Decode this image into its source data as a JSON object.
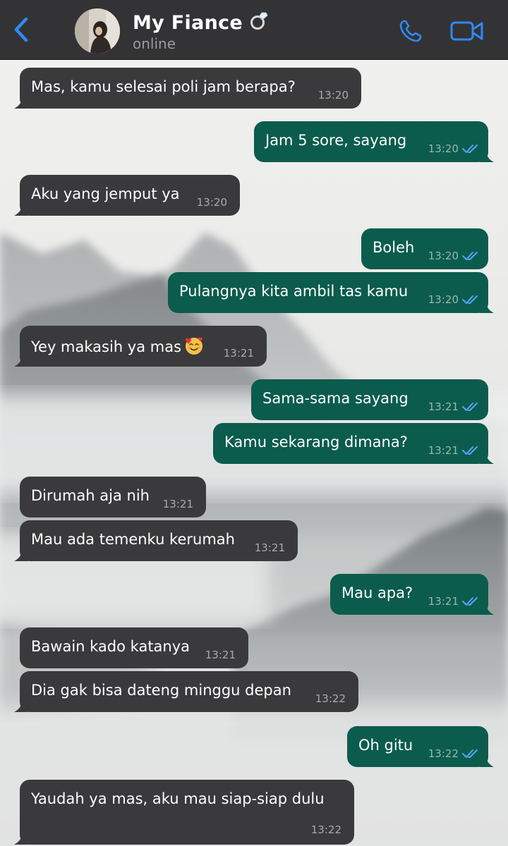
{
  "header": {
    "contact_name": "My Fiance",
    "status": "online"
  },
  "colors": {
    "header_bg": "#2c2c2e",
    "accent": "#2f8af5",
    "incoming_bubble": "#3a3a3c",
    "outgoing_bubble": "#0b5c4d",
    "read_ticks": "#53a6ff"
  },
  "messages": [
    {
      "dir": "in",
      "text": "Mas, kamu selesai poli jam berapa?",
      "time": "13:20"
    },
    {
      "dir": "out",
      "text": "Jam 5 sore, sayang",
      "time": "13:20",
      "status": "read"
    },
    {
      "dir": "in",
      "text": "Aku yang jemput ya",
      "time": "13:20"
    },
    {
      "dir": "out",
      "text": "Boleh",
      "time": "13:20",
      "status": "read"
    },
    {
      "dir": "out",
      "text": "Pulangnya kita ambil tas kamu",
      "time": "13:20",
      "status": "read"
    },
    {
      "dir": "in",
      "text": "Yey makasih ya mas",
      "emoji": "smiling-face-with-hearts",
      "time": "13:21"
    },
    {
      "dir": "out",
      "text": "Sama-sama sayang",
      "time": "13:21",
      "status": "read"
    },
    {
      "dir": "out",
      "text": "Kamu sekarang dimana?",
      "time": "13:21",
      "status": "read"
    },
    {
      "dir": "in",
      "text": "Dirumah aja nih",
      "time": "13:21"
    },
    {
      "dir": "in",
      "text": "Mau ada temenku kerumah",
      "time": "13:21"
    },
    {
      "dir": "out",
      "text": "Mau apa?",
      "time": "13:21",
      "status": "read"
    },
    {
      "dir": "in",
      "text": "Bawain kado katanya",
      "time": "13:21"
    },
    {
      "dir": "in",
      "text": "Dia gak bisa dateng minggu depan",
      "time": "13:22"
    },
    {
      "dir": "out",
      "text": "Oh gitu",
      "time": "13:22",
      "status": "read"
    },
    {
      "dir": "in",
      "text": "Yaudah ya mas, aku mau siap-siap dulu",
      "time": "13:22"
    }
  ]
}
